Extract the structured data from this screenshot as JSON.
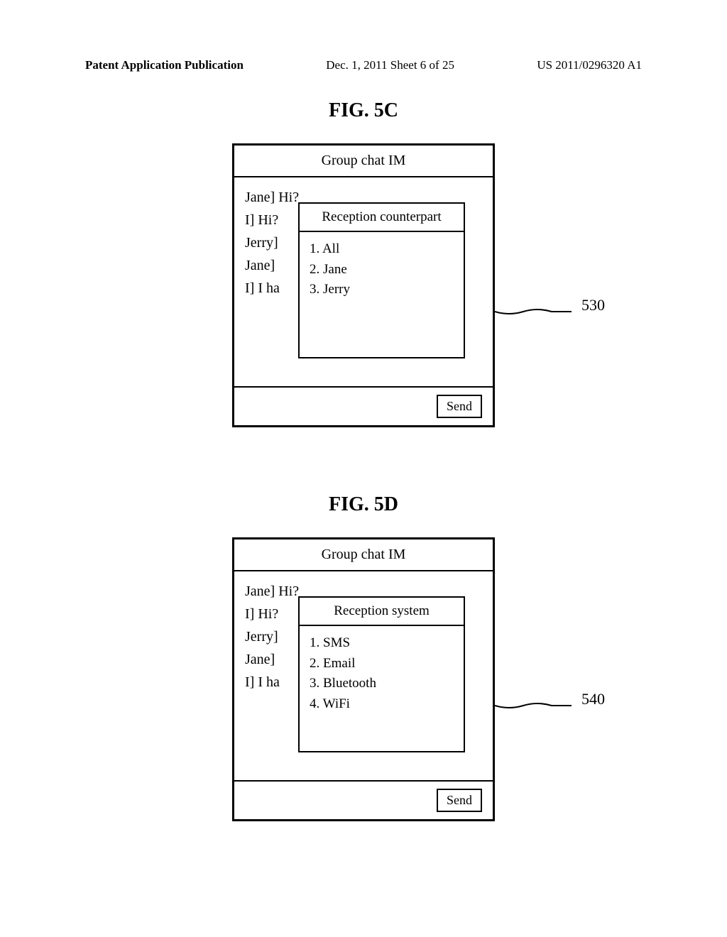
{
  "header": {
    "left": "Patent Application Publication",
    "center": "Dec. 1, 2011   Sheet 6 of 25",
    "right": "US 2011/0296320 A1"
  },
  "fig5c": {
    "label": "FIG. 5C",
    "title": "Group chat IM",
    "chat_lines": [
      "Jane] Hi?",
      "I] Hi?",
      "Jerry]",
      "Jane]",
      "I] I ha"
    ],
    "popup_title": "Reception counterpart",
    "popup_items": [
      "1. All",
      "2. Jane",
      "3. Jerry"
    ],
    "send_label": "Send",
    "ref_number": "530"
  },
  "fig5d": {
    "label": "FIG. 5D",
    "title": "Group chat IM",
    "chat_lines": [
      "Jane] Hi?",
      "I] Hi?",
      "Jerry]",
      "Jane]",
      "I] I ha"
    ],
    "popup_title": "Reception system",
    "popup_items": [
      "1. SMS",
      "2. Email",
      "3. Bluetooth",
      "4. WiFi"
    ],
    "send_label": "Send",
    "ref_number": "540"
  }
}
